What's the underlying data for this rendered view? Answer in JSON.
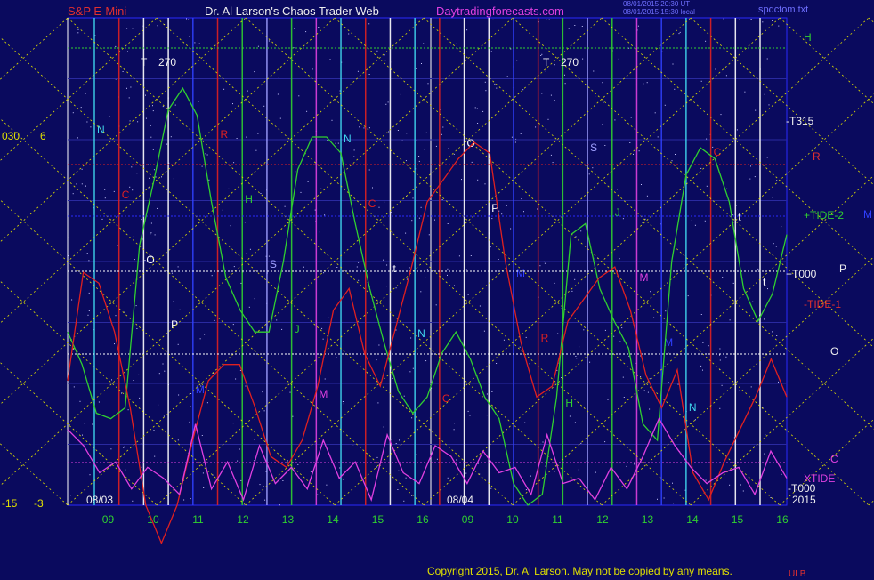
{
  "header": {
    "instrument": "S&P E-Mini",
    "title": "Dr. Al Larson's Chaos Trader Web",
    "site": "Daytradingforecasts.com",
    "timestamp1": "08/01/2015 20:30 UT",
    "timestamp2": "08/01/2015 15:30 local",
    "filename": "spdctom.txt"
  },
  "footer": {
    "copyright": "Copyright 2015, Dr. Al Larson. May not be copied by any means.",
    "corner": "ULB"
  },
  "chart_data": {
    "type": "line",
    "axes": {
      "left_outer_ticks": [
        "030",
        "-15"
      ],
      "left_inner_ticks": [
        "6",
        "-3"
      ],
      "x_tick_labels": [
        "09",
        "10",
        "11",
        "12",
        "13",
        "14",
        "15",
        "16",
        "09",
        "10",
        "11",
        "12",
        "13",
        "14",
        "15",
        "16"
      ],
      "date_labels": [
        "08/03",
        "08/04"
      ],
      "year": "2015"
    },
    "right_labels": {
      "H": "H",
      "T315": "-T315",
      "R": "R",
      "TIDE2": "+TIDE-2",
      "M": "M",
      "T000": "+T000",
      "P": "P",
      "TIDE1": "-TIDE-1",
      "O": "O",
      "C": "C",
      "XTIDE": "XTIDE",
      "T000b": "-T000"
    },
    "timelines": [
      {
        "label": "T",
        "extra": "270"
      },
      {
        "label": "T",
        "extra": "270"
      }
    ],
    "line_letters": [
      {
        "letter": "N",
        "color": "#40d8f0"
      },
      {
        "letter": "C",
        "color": "#e02020"
      },
      {
        "letter": "O",
        "color": "#ffffff"
      },
      {
        "letter": "P",
        "color": "#ffffff"
      },
      {
        "letter": "M",
        "color": "#3040ff"
      },
      {
        "letter": "R",
        "color": "#e02020"
      },
      {
        "letter": "H",
        "color": "#30d030"
      },
      {
        "letter": "S",
        "color": "#a0a0ff"
      },
      {
        "letter": "J",
        "color": "#30d030"
      },
      {
        "letter": "M",
        "color": "#e040e0"
      },
      {
        "letter": "N",
        "color": "#40d8f0"
      },
      {
        "letter": "C",
        "color": "#e02020"
      },
      {
        "letter": "t",
        "color": "#ffffff"
      },
      {
        "letter": "N",
        "color": "#40d8f0"
      },
      {
        "letter": "C",
        "color": "#e02020"
      },
      {
        "letter": "O",
        "color": "#ffffff"
      },
      {
        "letter": "P",
        "color": "#ffffff"
      },
      {
        "letter": "M",
        "color": "#3040ff"
      },
      {
        "letter": "R",
        "color": "#e02020"
      },
      {
        "letter": "H",
        "color": "#30d030"
      },
      {
        "letter": "S",
        "color": "#a0a0ff"
      },
      {
        "letter": "J",
        "color": "#30d030"
      },
      {
        "letter": "M",
        "color": "#e040e0"
      },
      {
        "letter": "M",
        "color": "#3040ff"
      },
      {
        "letter": "N",
        "color": "#40d8f0"
      },
      {
        "letter": "C",
        "color": "#e02020"
      },
      {
        "letter": "t",
        "color": "#ffffff"
      },
      {
        "letter": "t",
        "color": "#ffffff"
      }
    ],
    "series": [
      {
        "name": "TIDE-2",
        "color": "#30d030",
        "y": [
          0.2,
          -0.4,
          -1.3,
          -1.4,
          -1.2,
          1.8,
          3.0,
          4.3,
          4.7,
          4.2,
          2.6,
          1.2,
          0.6,
          0.2,
          0.2,
          1.5,
          3.2,
          3.8,
          3.8,
          3.5,
          2.2,
          1.0,
          0.0,
          -0.9,
          -1.3,
          -1.0,
          -0.2,
          0.2,
          -0.3,
          -1.0,
          -1.4,
          -2.6,
          -3.0,
          -2.8,
          -1.0,
          2.0,
          2.2,
          1.0,
          0.4,
          -0.1,
          -1.5,
          -1.8,
          1.5,
          3.1,
          3.6,
          3.4,
          2.6,
          1.0,
          0.4,
          0.9,
          2.0
        ]
      },
      {
        "name": "TIDE-1",
        "color": "#e02020",
        "y": [
          -0.7,
          1.3,
          1.1,
          0.2,
          -1.2,
          -3.0,
          -3.7,
          -3.0,
          -1.8,
          -0.7,
          -0.4,
          -0.4,
          -1.2,
          -2.1,
          -2.3,
          -1.8,
          -0.8,
          0.6,
          1.0,
          -0.2,
          -0.8,
          0.3,
          1.4,
          2.6,
          3.0,
          3.4,
          3.7,
          3.5,
          1.5,
          0.0,
          -1.0,
          -0.8,
          0.4,
          0.8,
          1.2,
          1.4,
          0.6,
          -0.6,
          -1.2,
          -0.5,
          -2.4,
          -2.9,
          -2.2,
          -1.6,
          -1.0,
          -0.3,
          -1.0
        ]
      },
      {
        "name": "XTIDE",
        "color": "#e040e0",
        "y": [
          -1.6,
          -1.9,
          -2.4,
          -2.2,
          -2.7,
          -2.3,
          -2.5,
          -2.8,
          -1.5,
          -2.7,
          -2.2,
          -2.9,
          -1.9,
          -2.6,
          -2.3,
          -2.7,
          -1.8,
          -2.5,
          -2.2,
          -2.9,
          -1.7,
          -2.4,
          -2.6,
          -1.9,
          -2.1,
          -2.6,
          -2.0,
          -2.4,
          -2.3,
          -2.8,
          -1.7,
          -2.6,
          -2.5,
          -2.9,
          -2.3,
          -2.7,
          -2.1,
          -1.4,
          -1.9,
          -2.3,
          -2.6,
          -2.4,
          -2.3,
          -2.8,
          -2.0,
          -2.5
        ]
      }
    ],
    "ylim": [
      -3,
      6
    ]
  }
}
